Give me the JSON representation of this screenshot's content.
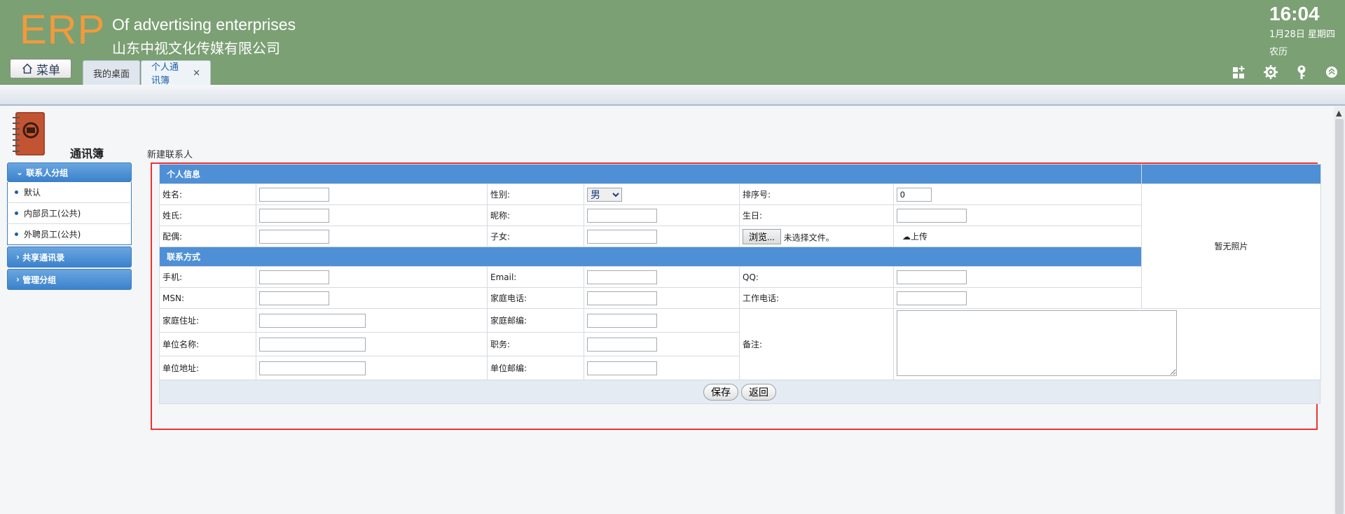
{
  "app": {
    "logo": "ERP",
    "title_en": "Of advertising enterprises",
    "title_cn": "山东中视文化传媒有限公司",
    "menu_label": "菜单"
  },
  "tabs": [
    {
      "label": "我的桌面"
    },
    {
      "label": "个人通讯簿",
      "close": "×"
    }
  ],
  "clock": {
    "time": "16:04",
    "date": "1月28日 星期四",
    "lunar": "农历"
  },
  "header_icons": [
    "grid-plus-icon",
    "gear-icon",
    "key-icon",
    "chevron-up-circle-icon"
  ],
  "sidebar": {
    "title": "通讯簿",
    "groups_header": "联系人分组",
    "items": [
      {
        "label": "默认"
      },
      {
        "label": "内部员工(公共)"
      },
      {
        "label": "外聘员工(公共)"
      }
    ],
    "shared": "共享通讯录",
    "manage": "管理分组"
  },
  "form": {
    "heading": "新建联系人",
    "section_personal": "个人信息",
    "section_contact": "联系方式",
    "labels": {
      "name": "姓名:",
      "gender": "性别:",
      "order": "排序号:",
      "surname": "姓氏:",
      "nickname": "昵称:",
      "birthday": "生日:",
      "spouse": "配偶:",
      "children": "子女:",
      "mobile": "手机:",
      "email": "Email:",
      "qq": "QQ:",
      "msn": "MSN:",
      "home_phone": "家庭电话:",
      "work_phone": "工作电话:",
      "home_addr": "家庭住址:",
      "home_zip": "家庭邮编:",
      "company": "单位名称:",
      "position": "职务:",
      "company_addr": "单位地址:",
      "company_zip": "单位邮编:",
      "remark": "备注:"
    },
    "gender_value": "男",
    "order_value": "0",
    "browse_label": "浏览...",
    "no_file": "未选择文件。",
    "upload_label": "上传",
    "no_photo": "暂无照片",
    "save": "保存",
    "back": "返回"
  }
}
